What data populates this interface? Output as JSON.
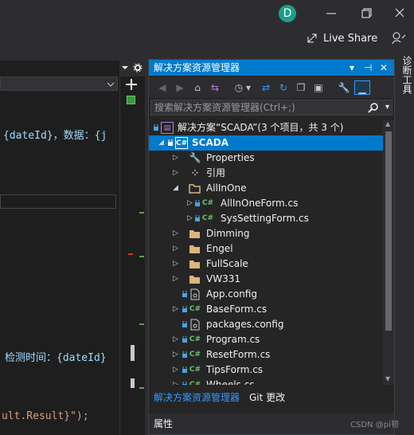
{
  "window": {
    "avatar_initial": "D",
    "live_share_label": "Live Share"
  },
  "editor": {
    "lines": [
      {
        "text": "{dateId}，数据：{j"
      },
      {
        "text": "检测时间：{dateId}"
      },
      {
        "text": "ult.Result}\");"
      }
    ]
  },
  "solution_explorer": {
    "title": "解决方案资源管理器",
    "search_placeholder": "搜索解决方案资源管理器(Ctrl+;)",
    "tree": [
      {
        "label": "解决方案“SCADA”(3 个项目，共 3 个)",
        "icon": "solution-icon",
        "arrow": "",
        "level": 0
      },
      {
        "label": "SCADA",
        "icon": "csharp-project-icon",
        "arrow": "◢",
        "level": 1,
        "selected": true
      },
      {
        "label": "Properties",
        "icon": "wrench-icon",
        "arrow": "▷",
        "level": 2
      },
      {
        "label": "引用",
        "icon": "references-icon",
        "arrow": "▷",
        "level": 2
      },
      {
        "label": "AllInOne",
        "icon": "folder-open-icon",
        "arrow": "◢",
        "level": 2
      },
      {
        "label": "AllInOneForm.cs",
        "icon": "csharp-file-icon",
        "arrow": "▷",
        "level": 3
      },
      {
        "label": "SysSettingForm.cs",
        "icon": "csharp-file-icon",
        "arrow": "▷",
        "level": 3
      },
      {
        "label": "Dimming",
        "icon": "folder-icon",
        "arrow": "▷",
        "level": 2
      },
      {
        "label": "Engel",
        "icon": "folder-icon",
        "arrow": "▷",
        "level": 2
      },
      {
        "label": "FullScale",
        "icon": "folder-icon",
        "arrow": "▷",
        "level": 2
      },
      {
        "label": "VW331",
        "icon": "folder-icon",
        "arrow": "▷",
        "level": 2
      },
      {
        "label": "App.config",
        "icon": "config-file-icon",
        "arrow": "",
        "level": 2
      },
      {
        "label": "BaseForm.cs",
        "icon": "csharp-file-icon",
        "arrow": "▷",
        "level": 2
      },
      {
        "label": "packages.config",
        "icon": "config-file-icon",
        "arrow": "",
        "level": 2
      },
      {
        "label": "Program.cs",
        "icon": "csharp-file-icon",
        "arrow": "▷",
        "level": 2
      },
      {
        "label": "ResetForm.cs",
        "icon": "csharp-file-icon",
        "arrow": "▷",
        "level": 2
      },
      {
        "label": "TipsForm.cs",
        "icon": "csharp-file-icon",
        "arrow": "▷",
        "level": 2
      },
      {
        "label": "Wheels.cs",
        "icon": "csharp-file-icon",
        "arrow": "▷",
        "level": 2
      }
    ],
    "bottom_tabs": [
      "解决方案资源管理器",
      "Git 更改"
    ],
    "properties_label": "属性"
  },
  "side_tab_label": "诊断工具",
  "watermark": "CSDN @pi韧",
  "colors": {
    "accent": "#007acc",
    "csharp_green": "#6ac169",
    "folder": "#dcb67a"
  }
}
